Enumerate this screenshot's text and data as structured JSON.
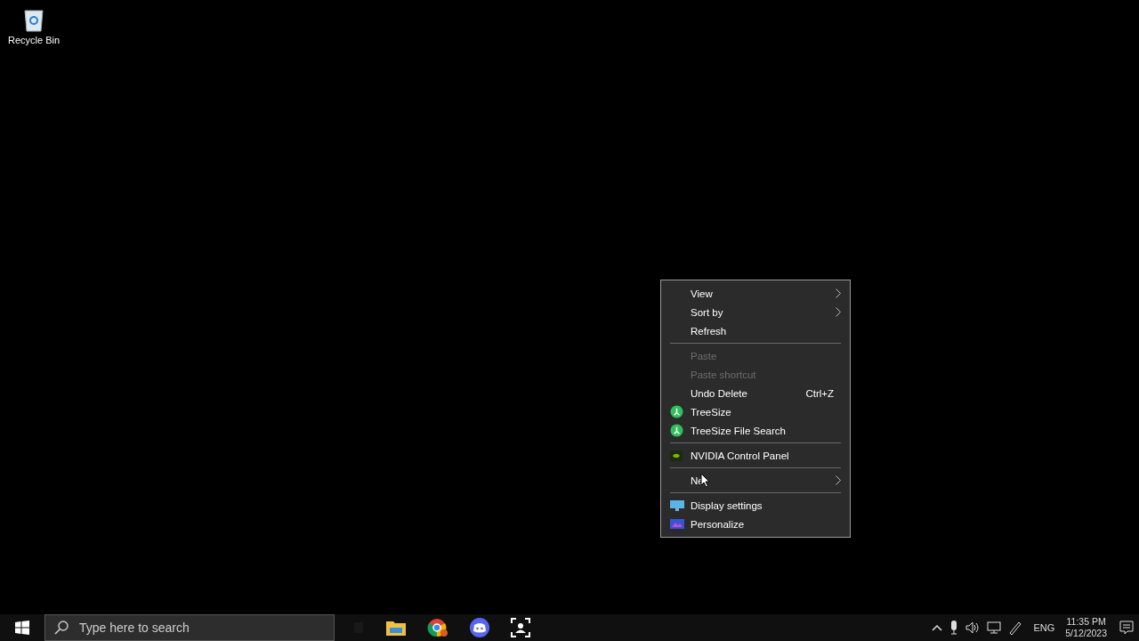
{
  "desktop_icons": [
    {
      "label": "Recycle Bin"
    }
  ],
  "context_menu": {
    "items": [
      {
        "kind": "item",
        "label": "View",
        "submenu": true,
        "disabled": false
      },
      {
        "kind": "item",
        "label": "Sort by",
        "submenu": true,
        "disabled": false
      },
      {
        "kind": "item",
        "label": "Refresh",
        "submenu": false,
        "disabled": false
      },
      {
        "kind": "separator"
      },
      {
        "kind": "item",
        "label": "Paste",
        "submenu": false,
        "disabled": true
      },
      {
        "kind": "item",
        "label": "Paste shortcut",
        "submenu": false,
        "disabled": true
      },
      {
        "kind": "item",
        "label": "Undo Delete",
        "shortcut": "Ctrl+Z",
        "submenu": false,
        "disabled": false
      },
      {
        "kind": "item",
        "label": "TreeSize",
        "submenu": false,
        "disabled": false
      },
      {
        "kind": "item",
        "label": "TreeSize File Search",
        "submenu": false,
        "disabled": false
      },
      {
        "kind": "separator"
      },
      {
        "kind": "item",
        "label": "NVIDIA Control Panel",
        "submenu": false,
        "disabled": false
      },
      {
        "kind": "separator"
      },
      {
        "kind": "item",
        "label": "Ne",
        "submenu": true,
        "disabled": false,
        "cursor": true
      },
      {
        "kind": "separator"
      },
      {
        "kind": "item",
        "label": "Display settings",
        "submenu": false,
        "disabled": false
      },
      {
        "kind": "item",
        "label": "Personalize",
        "submenu": false,
        "disabled": false
      }
    ]
  },
  "taskbar": {
    "search": {
      "placeholder": "Type here to search"
    },
    "tray": {
      "language": "ENG",
      "time": "11:35 PM",
      "date": "5/12/2023"
    }
  }
}
